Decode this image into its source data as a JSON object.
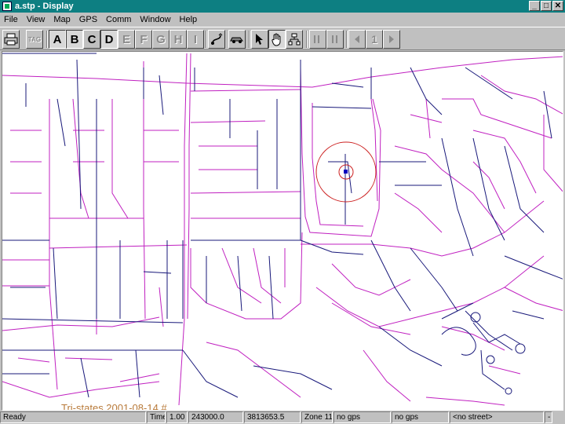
{
  "window": {
    "title": "a.stp - Display",
    "min": "_",
    "max": "□",
    "close": "✕"
  },
  "menu": [
    "File",
    "View",
    "Map",
    "GPS",
    "Comm",
    "Window",
    "Help"
  ],
  "toolbar": {
    "letters": [
      {
        "label": "A",
        "state": "pressed"
      },
      {
        "label": "B",
        "state": "pressed"
      },
      {
        "label": "C",
        "state": "normal"
      },
      {
        "label": "D",
        "state": "pressed"
      },
      {
        "label": "E",
        "state": "disabled"
      },
      {
        "label": "F",
        "state": "disabled"
      },
      {
        "label": "G",
        "state": "disabled"
      },
      {
        "label": "H",
        "state": "disabled"
      },
      {
        "label": "I",
        "state": "disabled"
      }
    ],
    "tag_label": "TAG",
    "page_number": "1"
  },
  "map": {
    "label": "Tri-states 2001-08-14 #",
    "colors": {
      "road_primary": "#c020c0",
      "road_secondary": "#18187a",
      "marker": "#cc2020",
      "position": "#0000c0",
      "label": "#b87a3a"
    }
  },
  "status": {
    "ready": "Ready",
    "time_label": "Time",
    "scale": "1.00",
    "coord1": "243000.0",
    "coord2": "3813653.5",
    "zone": "Zone 11",
    "gps1": "no gps",
    "gps2": "no gps",
    "street": "<no street>",
    "end": "-"
  }
}
